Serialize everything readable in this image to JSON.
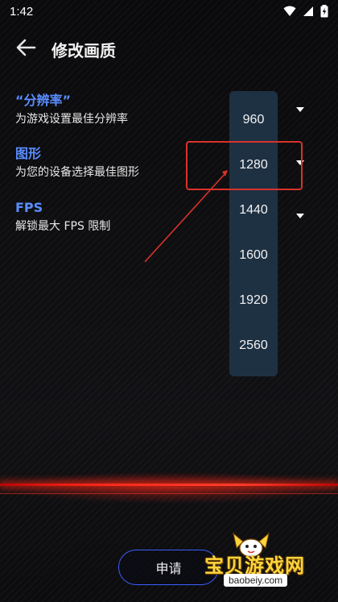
{
  "status_bar": {
    "time": "1:42",
    "icons": [
      "wifi-icon",
      "signal-icon",
      "battery-charging-icon"
    ]
  },
  "header": {
    "back_icon": "arrow-left-icon",
    "title": "修改画质"
  },
  "settings": [
    {
      "label": "“分辨率”",
      "description": "为游戏设置最佳分辨率"
    },
    {
      "label": "图形",
      "description": "为您的设备选择最佳图形"
    },
    {
      "label": "FPS",
      "description": "解锁最大 FPS 限制"
    }
  ],
  "dropdown": {
    "options": [
      "960",
      "1280",
      "1440",
      "1600",
      "1920",
      "2560"
    ],
    "highlighted": "1280"
  },
  "apply_button": {
    "label": "申请"
  },
  "watermark": {
    "text": "宝贝游戏网",
    "url": "baobeiy.com"
  },
  "colors": {
    "accent": "#5a8dff",
    "dropdown_bg": "#1e3143",
    "annotation": "#d9322a",
    "button_border": "#3b5fff",
    "red_line": "#ff2a1a"
  }
}
